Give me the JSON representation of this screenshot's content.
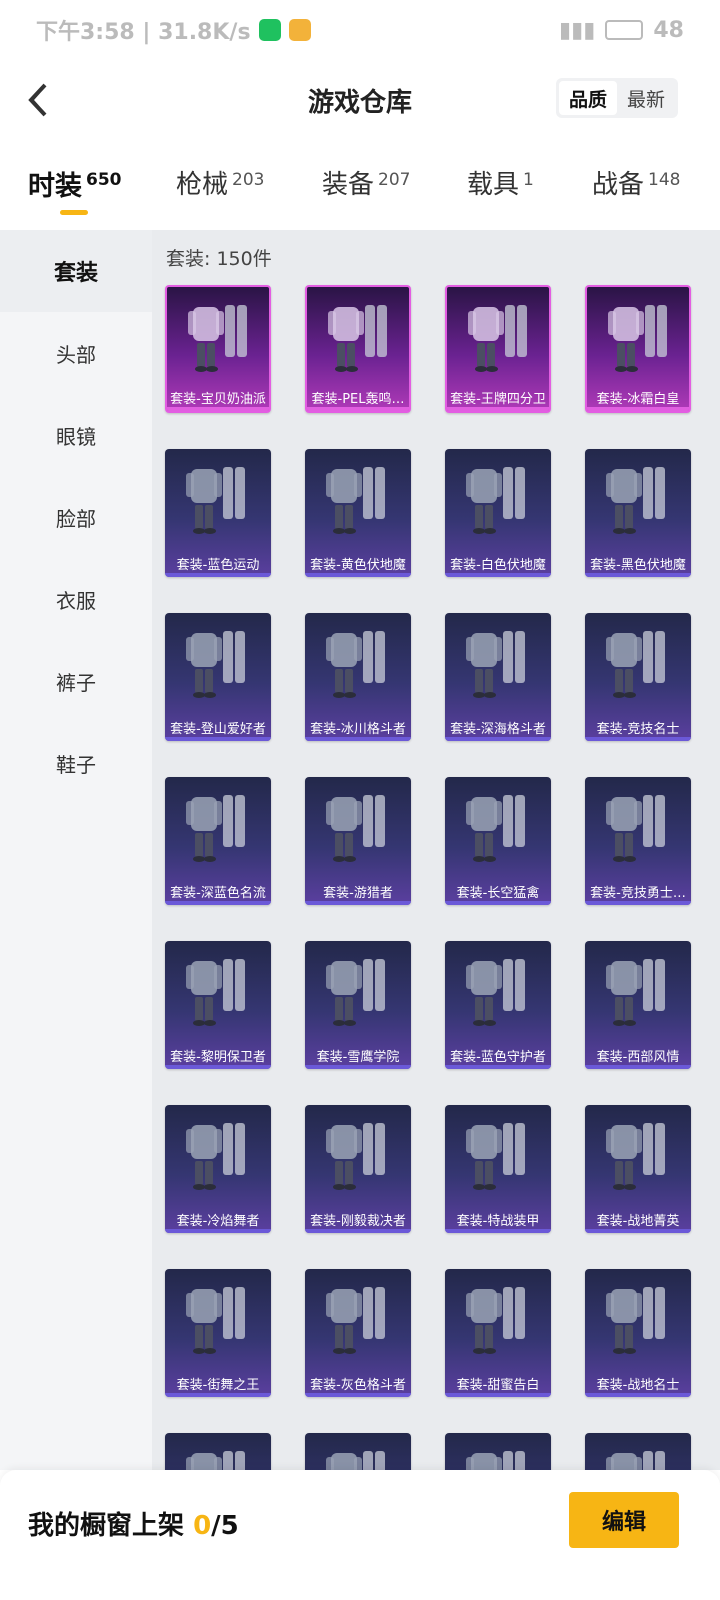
{
  "statusbar": {
    "left_text": "下午3:58 | 31.8K/s",
    "battery": "48"
  },
  "header": {
    "title": "游戏仓库",
    "sort": [
      "品质",
      "最新"
    ]
  },
  "tabs": [
    {
      "label": "时装",
      "count": "650"
    },
    {
      "label": "枪械",
      "count": "203"
    },
    {
      "label": "装备",
      "count": "207"
    },
    {
      "label": "载具",
      "count": "1"
    },
    {
      "label": "战备",
      "count": "148"
    }
  ],
  "sidebar": [
    "套装",
    "头部",
    "眼镜",
    "脸部",
    "衣服",
    "裤子",
    "鞋子"
  ],
  "content": {
    "count_label": "套装: 150件"
  },
  "items": [
    {
      "name": "套装-宝贝奶油派",
      "tier": "legendary"
    },
    {
      "name": "套装-PEL轰鸣…",
      "tier": "legendary"
    },
    {
      "name": "套装-王牌四分卫",
      "tier": "legendary"
    },
    {
      "name": "套装-冰霜白皇",
      "tier": "legendary"
    },
    {
      "name": "套装-蓝色运动",
      "tier": "epic"
    },
    {
      "name": "套装-黄色伏地魔",
      "tier": "epic"
    },
    {
      "name": "套装-白色伏地魔",
      "tier": "epic"
    },
    {
      "name": "套装-黑色伏地魔",
      "tier": "epic"
    },
    {
      "name": "套装-登山爱好者",
      "tier": "epic"
    },
    {
      "name": "套装-冰川格斗者",
      "tier": "epic"
    },
    {
      "name": "套装-深海格斗者",
      "tier": "epic"
    },
    {
      "name": "套装-竞技名士",
      "tier": "epic"
    },
    {
      "name": "套装-深蓝色名流",
      "tier": "epic"
    },
    {
      "name": "套装-游猎者",
      "tier": "epic"
    },
    {
      "name": "套装-长空猛禽",
      "tier": "epic"
    },
    {
      "name": "套装-竞技勇士…",
      "tier": "epic"
    },
    {
      "name": "套装-黎明保卫者",
      "tier": "epic"
    },
    {
      "name": "套装-雪鹰学院",
      "tier": "epic"
    },
    {
      "name": "套装-蓝色守护者",
      "tier": "epic"
    },
    {
      "name": "套装-西部风情",
      "tier": "epic"
    },
    {
      "name": "套装-冷焰舞者",
      "tier": "epic"
    },
    {
      "name": "套装-刚毅裁决者",
      "tier": "epic"
    },
    {
      "name": "套装-特战装甲",
      "tier": "epic"
    },
    {
      "name": "套装-战地菁英",
      "tier": "epic"
    },
    {
      "name": "套装-街舞之王",
      "tier": "epic"
    },
    {
      "name": "套装-灰色格斗者",
      "tier": "epic"
    },
    {
      "name": "套装-甜蜜告白",
      "tier": "epic"
    },
    {
      "name": "套装-战地名士",
      "tier": "epic"
    },
    {
      "name": "",
      "tier": "epic"
    },
    {
      "name": "",
      "tier": "epic"
    },
    {
      "name": "",
      "tier": "epic"
    },
    {
      "name": "",
      "tier": "epic"
    }
  ],
  "bottom": {
    "label": "我的橱窗上架",
    "count": "0",
    "total": "/5",
    "edit": "编辑"
  },
  "colors": {
    "accent": "#f7b514",
    "legendary": "#e35de2",
    "epic": "#6b59d8"
  }
}
